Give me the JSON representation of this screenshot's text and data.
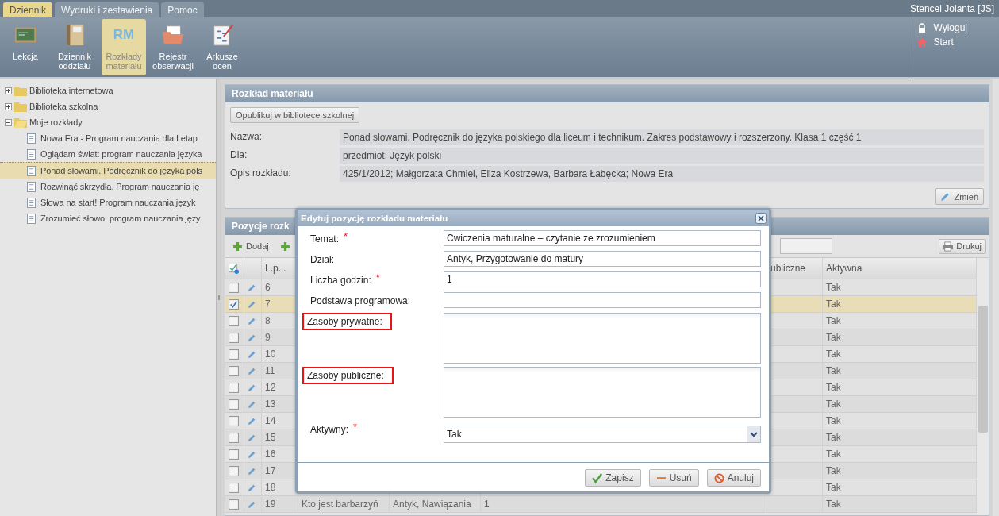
{
  "menu_tabs": [
    {
      "label": "Dziennik",
      "selected": true
    },
    {
      "label": "Wydruki i zestawienia",
      "selected": false
    },
    {
      "label": "Pomoc",
      "selected": false
    }
  ],
  "user": "Stencel Jolanta [JS]",
  "toolbar": [
    {
      "label": "Lekcja",
      "kind": "board",
      "selected": false
    },
    {
      "label": "Dziennik oddziału",
      "kind": "book",
      "selected": false
    },
    {
      "label": "Rozkłady materiału",
      "kind": "letters",
      "icon_text": "RM",
      "selected": true
    },
    {
      "label": "Rejestr obserwacji",
      "kind": "folder",
      "selected": false
    },
    {
      "label": "Arkusze ocen",
      "kind": "sheet",
      "selected": false
    }
  ],
  "user_links": [
    {
      "label": "Wyloguj",
      "kind": "lock"
    },
    {
      "label": "Start",
      "kind": "home"
    }
  ],
  "tree": [
    {
      "label": "Biblioteka internetowa",
      "expanded": false,
      "selected": false
    },
    {
      "label": "Biblioteka szkolna",
      "expanded": false,
      "selected": false
    },
    {
      "label": "Moje rozkłady",
      "expanded": true,
      "selected": false,
      "children": [
        {
          "label": "Nowa Era - Program nauczania dla I etap",
          "selected": false
        },
        {
          "label": "Oglądam świat: program nauczania języka",
          "selected": false
        },
        {
          "label": "Ponad słowami. Podręcznik do języka pols",
          "selected": true
        },
        {
          "label": "Rozwinąć skrzydła. Program nauczania ję",
          "selected": false
        },
        {
          "label": "Słowa na start! Program nauczania język",
          "selected": false
        },
        {
          "label": "Zrozumieć słowo: program nauczania języ",
          "selected": false
        }
      ]
    }
  ],
  "details_panel": {
    "title": "Rozkład materiału",
    "publish_button": "Opublikuj w bibliotece szkolnej",
    "fields": [
      {
        "label": "Nazwa:",
        "value": "Ponad słowami. Podręcznik do języka polskiego dla liceum i technikum. Zakres podstawowy i rozszerzony. Klasa 1 część 1"
      },
      {
        "label": "Dla:",
        "value": "przedmiot: Język polski"
      },
      {
        "label": "Opis rozkładu:",
        "value": "425/1/2012; Małgorzata Chmiel, Eliza Kostrzewa, Barbara Łabęcka; Nowa Era"
      }
    ],
    "edit_button": "Zmień"
  },
  "items_panel": {
    "title": "Pozycje rozk",
    "add_button": "Dodaj",
    "print_button": "Drukuj",
    "columns": {
      "lp": "L.p...",
      "column_7": "ubliczne",
      "active": "Aktywna"
    },
    "rows": [
      {
        "lp": "6",
        "checked": false,
        "selected": false,
        "active": "Tak"
      },
      {
        "lp": "7",
        "checked": true,
        "selected": true,
        "active": "Tak"
      },
      {
        "lp": "8",
        "checked": false,
        "selected": false,
        "active": "Tak"
      },
      {
        "lp": "9",
        "checked": false,
        "selected": false,
        "active": "Tak"
      },
      {
        "lp": "10",
        "checked": false,
        "selected": false,
        "active": "Tak"
      },
      {
        "lp": "11",
        "checked": false,
        "selected": false,
        "active": "Tak"
      },
      {
        "lp": "12",
        "checked": false,
        "selected": false,
        "active": "Tak"
      },
      {
        "lp": "13",
        "checked": false,
        "selected": false,
        "active": "Tak"
      },
      {
        "lp": "14",
        "checked": false,
        "selected": false,
        "active": "Tak"
      },
      {
        "lp": "15",
        "checked": false,
        "selected": false,
        "active": "Tak"
      },
      {
        "lp": "16",
        "checked": false,
        "selected": false,
        "active": "Tak"
      },
      {
        "lp": "17",
        "checked": false,
        "selected": false,
        "active": "Tak"
      },
      {
        "lp": "18",
        "checked": false,
        "selected": false,
        "active": "Tak"
      },
      {
        "lp": "19",
        "checked": false,
        "selected": false,
        "cells": [
          "Kto jest barbarzyń",
          "Antyk, Nawiązania",
          "1"
        ],
        "active": "Tak"
      }
    ]
  },
  "dialog": {
    "title": "Edytuj pozycję rozkładu materiału",
    "fields": [
      {
        "label": "Temat:",
        "kind": "text",
        "required_mark": "*",
        "highlighted": false,
        "value": "Ćwiczenia maturalne – czytanie ze zrozumieniem"
      },
      {
        "label": "Dział:",
        "kind": "text",
        "highlighted": false,
        "value": "Antyk, Przygotowanie do matury"
      },
      {
        "label": "Liczba godzin:",
        "kind": "text",
        "required_mark": "*",
        "highlighted": false,
        "value": "1"
      },
      {
        "label": "Podstawa programowa:",
        "kind": "text",
        "highlighted": false
      },
      {
        "label": "Zasoby prywatne:",
        "kind": "textarea",
        "highlighted": true
      },
      {
        "label": "Zasoby publiczne:",
        "kind": "textarea",
        "highlighted": true
      },
      {
        "label": "Aktywny:",
        "kind": "select",
        "required_mark": "*",
        "highlighted": false,
        "value": "Tak"
      }
    ],
    "buttons": [
      {
        "label": "Zapisz",
        "kind": "save"
      },
      {
        "label": "Usuń",
        "kind": "delete"
      },
      {
        "label": "Anuluj",
        "kind": "cancel"
      }
    ]
  }
}
